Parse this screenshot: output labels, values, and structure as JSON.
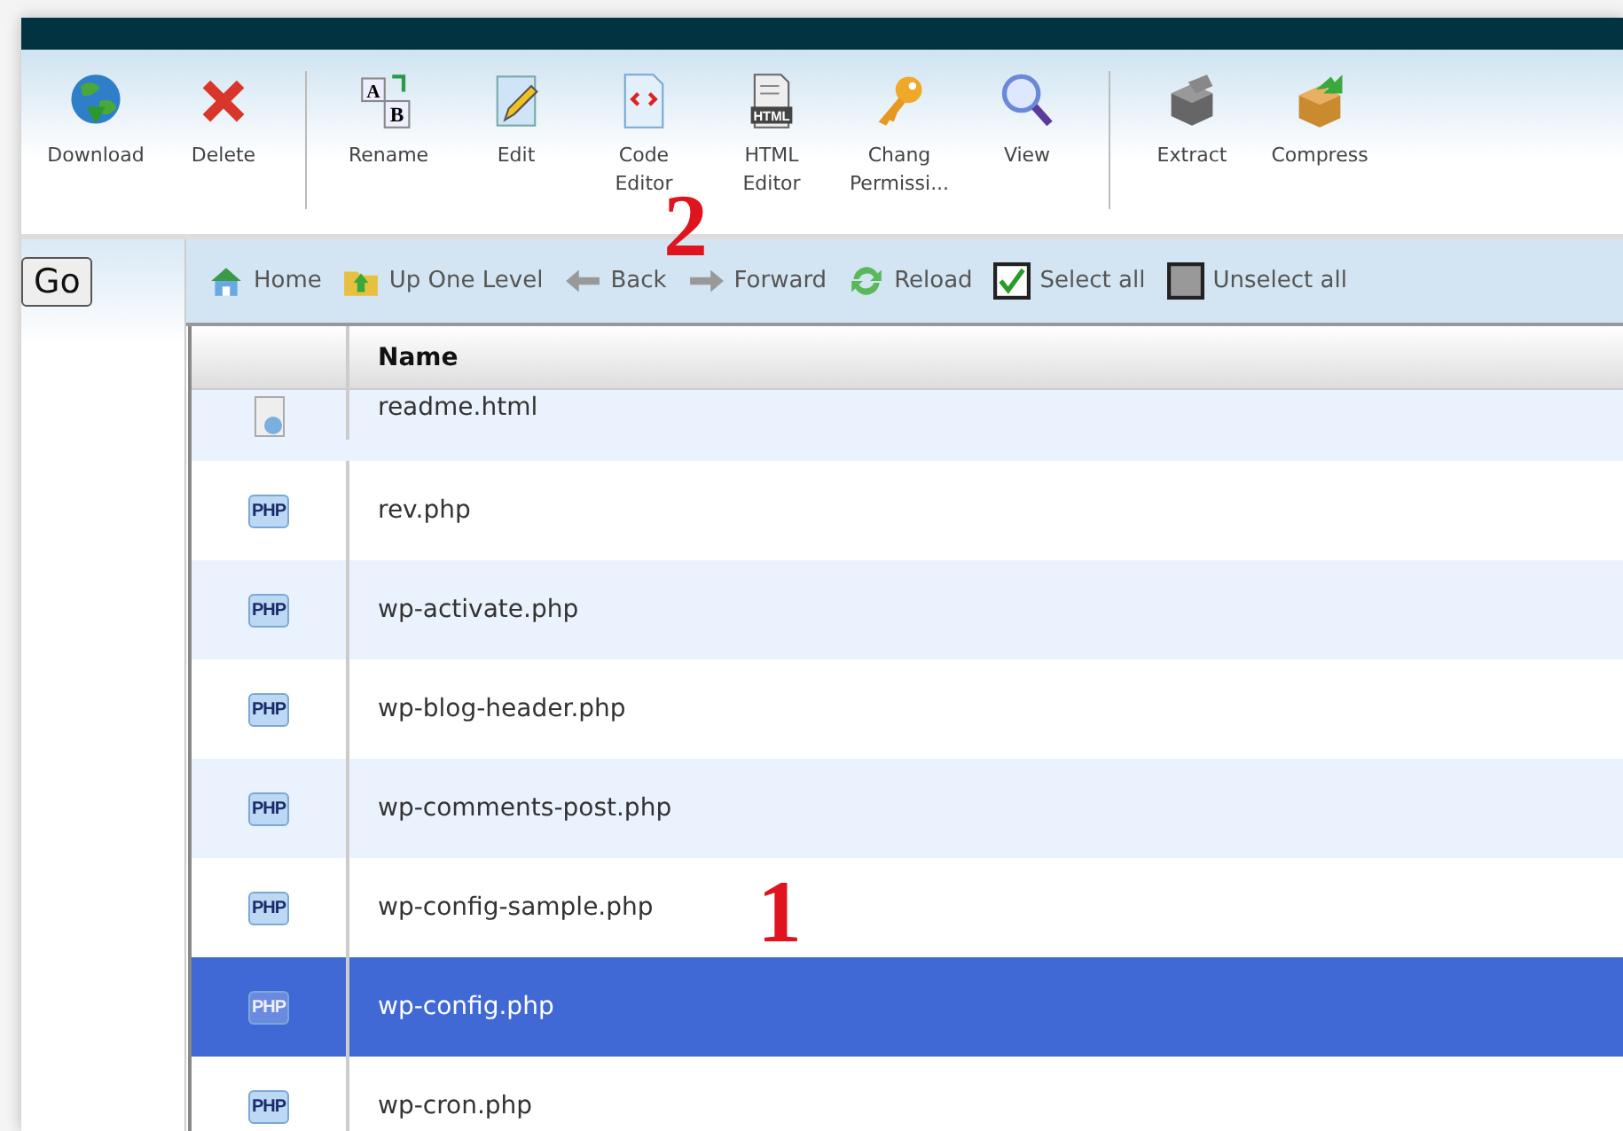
{
  "toolbar": [
    {
      "label": "Download"
    },
    {
      "label": "Delete"
    },
    {
      "kind": "separator"
    },
    {
      "label": "Rename",
      "icon_text": [
        "A",
        "B"
      ]
    },
    {
      "label": "Edit"
    },
    {
      "label": "Code\nEditor"
    },
    {
      "label": "HTML\nEditor",
      "icon_text": [
        "HTML"
      ]
    },
    {
      "label": "Chang\nPermissi..."
    },
    {
      "label": "View"
    },
    {
      "kind": "separator"
    },
    {
      "label": "Extract"
    },
    {
      "label": "Compress"
    }
  ],
  "go_button": "Go",
  "nav": [
    {
      "label": "Home"
    },
    {
      "label": "Up One Level"
    },
    {
      "label": "Back"
    },
    {
      "label": "Forward"
    },
    {
      "label": "Reload"
    },
    {
      "label": "Select all"
    },
    {
      "label": "Unselect all"
    }
  ],
  "table": {
    "columns": [
      "Name"
    ],
    "rows": [
      {
        "name": "readme.html",
        "selected": false
      },
      {
        "name": "rev.php",
        "icon_text": "PHP",
        "selected": false
      },
      {
        "name": "wp-activate.php",
        "icon_text": "PHP",
        "selected": false
      },
      {
        "name": "wp-blog-header.php",
        "icon_text": "PHP",
        "selected": false
      },
      {
        "name": "wp-comments-post.php",
        "icon_text": "PHP",
        "selected": false
      },
      {
        "name": "wp-config-sample.php",
        "icon_text": "PHP",
        "selected": false
      },
      {
        "name": "wp-config.php",
        "icon_text": "PHP",
        "selected": true
      },
      {
        "name": "wp-cron.php",
        "icon_text": "PHP",
        "selected": false
      }
    ]
  },
  "annotations": [
    "2",
    "1"
  ]
}
